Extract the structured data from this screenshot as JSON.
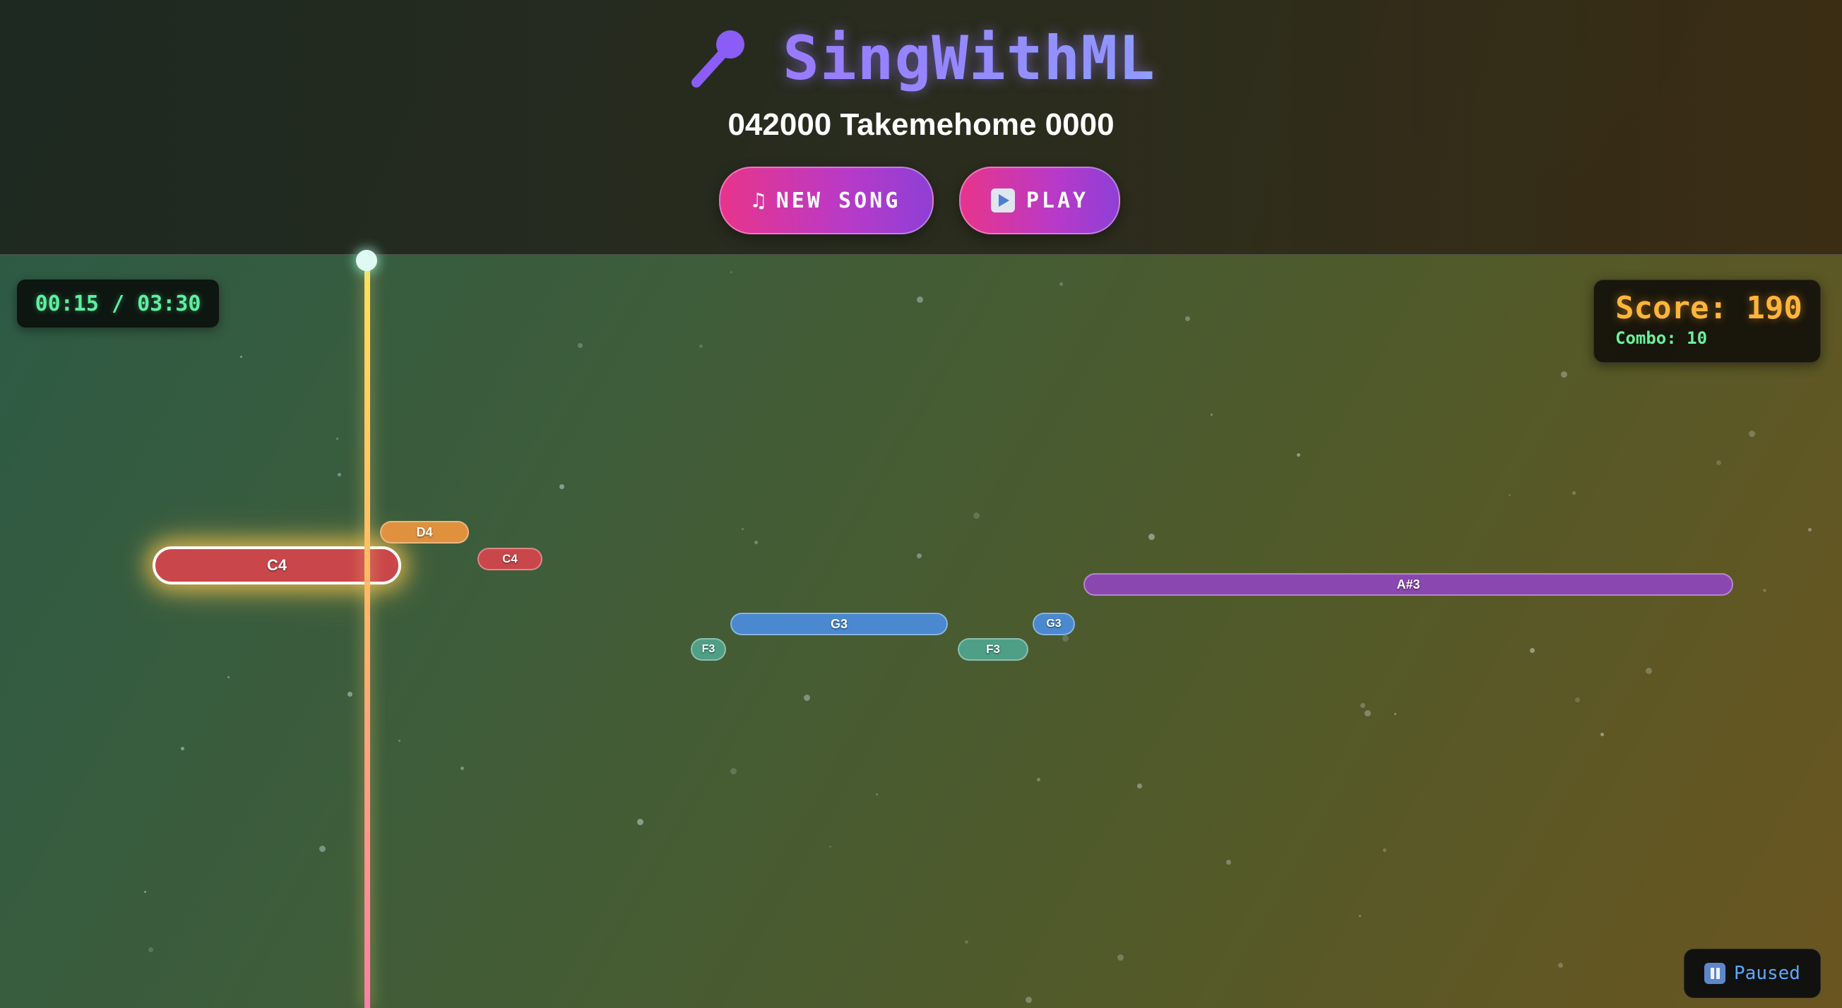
{
  "header": {
    "app_title": "SingWithML",
    "song_title": "042000 Takemehome 0000",
    "buttons": {
      "new_song": {
        "icon": "♫",
        "label": "NEW SONG"
      },
      "play": {
        "label": "PLAY"
      }
    }
  },
  "timer": {
    "text": "00:15 / 03:30"
  },
  "score": {
    "text": "Score: 190",
    "combo_text": "Combo: 10"
  },
  "status": {
    "label": "Paused"
  },
  "notes": [
    {
      "pitch": "C4",
      "color": "#c9474a",
      "active": true
    },
    {
      "pitch": "D4",
      "color": "#e0913e",
      "active": false
    },
    {
      "pitch": "C4",
      "color": "#c9474a",
      "active": false
    },
    {
      "pitch": "F3",
      "color": "#4e9f86",
      "active": false
    },
    {
      "pitch": "G3",
      "color": "#4a89cf",
      "active": false
    },
    {
      "pitch": "F3",
      "color": "#4e9f86",
      "active": false
    },
    {
      "pitch": "G3",
      "color": "#4a89cf",
      "active": false
    },
    {
      "pitch": "A#3",
      "color": "#8a47b0",
      "active": false
    }
  ],
  "colors": {
    "accent_pink": "#e8348b",
    "accent_purple": "#8e3fd6",
    "timer_green": "#5ef0a0",
    "score_orange": "#ffb53a",
    "paused_blue": "#5ea8ff"
  }
}
